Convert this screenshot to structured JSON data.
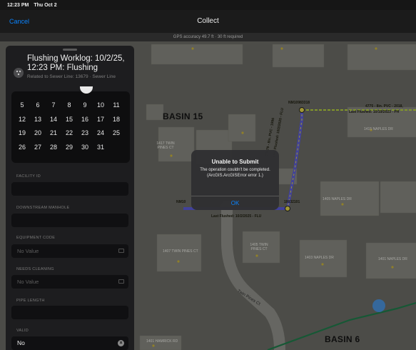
{
  "status_bar": {
    "time": "12:23 PM",
    "date": "Thu Oct 2"
  },
  "nav": {
    "cancel_label": "Cancel",
    "title": "Collect"
  },
  "gps": {
    "accuracy_text": "GPS accuracy 49.7 ft · 30 ft required"
  },
  "form": {
    "title": "Flushing Worklog: 10/2/25, 12:23 PM: Flushing",
    "subtitle": "Related to Sewer Line: 13679 · Sewer Line",
    "icon": "worklog-icon",
    "calendar_weeks": [
      [
        "5",
        "6",
        "7",
        "8",
        "9",
        "10",
        "11"
      ],
      [
        "12",
        "13",
        "14",
        "15",
        "16",
        "17",
        "18"
      ],
      [
        "19",
        "20",
        "21",
        "22",
        "23",
        "24",
        "25"
      ],
      [
        "26",
        "27",
        "28",
        "29",
        "30",
        "31"
      ]
    ],
    "fields": [
      {
        "label": "FACILITY ID",
        "value": "",
        "kind": "text"
      },
      {
        "label": "DOWNSTREAM MANHOLE",
        "value": "",
        "kind": "text"
      },
      {
        "label": "EQUIPMENT CODE",
        "value": "No Value",
        "kind": "picker"
      },
      {
        "label": "NEEDS CLEANING",
        "value": "No Value",
        "kind": "picker"
      },
      {
        "label": "PIPE LENGTH",
        "value": "",
        "kind": "text"
      },
      {
        "label": "VALID",
        "value": "No",
        "kind": "clearable"
      }
    ]
  },
  "alert": {
    "title": "Unable to Submit",
    "message": "The operation couldn't be completed. (ArcGIS.ArcGISError error 1.)",
    "ok_label": "OK"
  },
  "map": {
    "basin_labels": [
      "BASIN 15",
      "BASIN 6"
    ],
    "addresses": [
      "1417 TWIN PINES CT",
      "1415 NAPLES DR",
      "1405 NAPLES DR",
      "1407 TWIN PINES CT",
      "1405 TWIN PINES CT",
      "1403 NAPLES DR",
      "1401 NAPLES DR",
      "1401 HAMRICK RD"
    ],
    "feature_labels": {
      "manhole_top": "NM10983318",
      "pipe_top": "4775 - 8in. PVC - 2018,",
      "flushed_top": "Last Flushed: 10/19/2023 - PH",
      "pipe_vertical": "13679 - 8in. PVC - 1996",
      "flushed_vertical": "Last Flushed: 10/2/2025 - FLU",
      "manhole_left": "NM10",
      "manhole_bottom": "10032101",
      "flushed_bottom": "Last Flushed: 10/2/2025 - FLU"
    },
    "street_label": "Twin Pines Ct",
    "colors": {
      "accent": "#0a84ff",
      "selected_pipe": "#5b5bd6",
      "pipe_other": "#b4d03c",
      "basin_line": "#1f7a4a",
      "location_dot": "#4a90d9"
    }
  }
}
